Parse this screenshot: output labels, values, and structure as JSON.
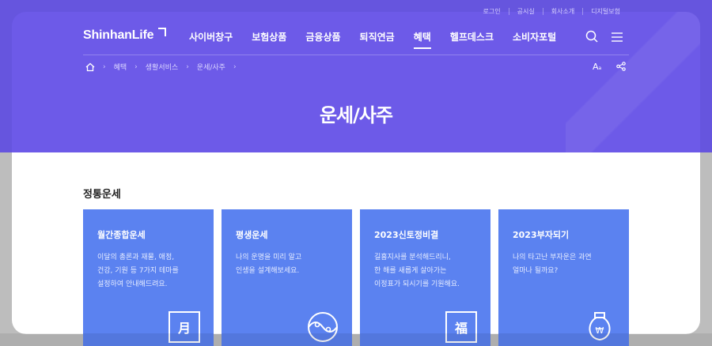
{
  "util_links": [
    "로그인",
    "공시실",
    "회사소개",
    "디지털보험"
  ],
  "brand": {
    "logo_text": "ShinhanLife"
  },
  "gnb": [
    {
      "label": "사이버창구",
      "active": false
    },
    {
      "label": "보험상품",
      "active": false
    },
    {
      "label": "금융상품",
      "active": false
    },
    {
      "label": "퇴직연금",
      "active": false
    },
    {
      "label": "혜택",
      "active": true
    },
    {
      "label": "헬프데스크",
      "active": false
    },
    {
      "label": "소비자포털",
      "active": false
    }
  ],
  "breadcrumb": [
    "혜택",
    "생활서비스",
    "운세/사주"
  ],
  "font_size_button": {
    "big": "A",
    "small": "a"
  },
  "page_title": "운세/사주",
  "section_title": "정통운세",
  "cards": [
    {
      "title": "월간종합운세",
      "desc": [
        "이달의 총론과 재물, 애정,",
        "건강, 기원 등 7가지 테마를",
        "설정하여 안내해드려요."
      ],
      "icon": "calendar-month-icon",
      "glyph": "月"
    },
    {
      "title": "평생운세",
      "desc": [
        "나의 운명을 미리 알고",
        "인생을 설계해보세요."
      ],
      "icon": "yin-yang-icon",
      "glyph": ""
    },
    {
      "title": "2023신토정비결",
      "desc": [
        "길흉지사를 분석해드리니,",
        "한 해를 새롭게 살아가는",
        "이정표가 되시기를 기원해요."
      ],
      "icon": "fortune-bok-icon",
      "glyph": "福"
    },
    {
      "title": "2023부자되기",
      "desc": [
        "나의 타고난 부자운은 과연",
        "얼마나 될까요?"
      ],
      "icon": "money-bag-icon",
      "glyph": "₩"
    }
  ],
  "colors": {
    "hero": "#6d5ae8",
    "card": "#5b82f0",
    "title": "#222222"
  }
}
